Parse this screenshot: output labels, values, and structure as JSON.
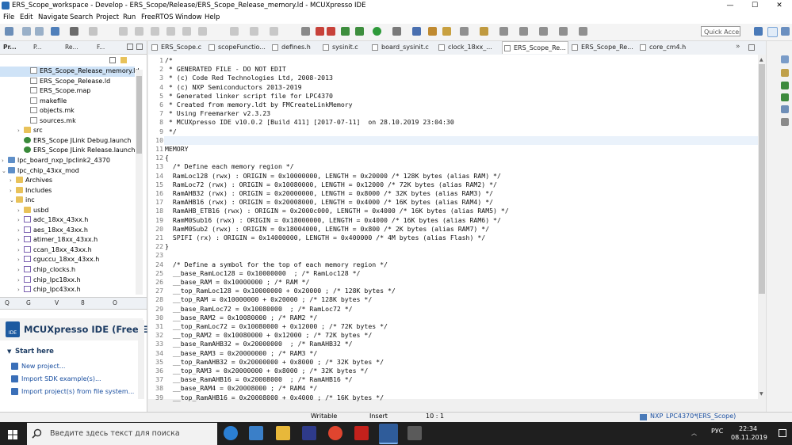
{
  "window": {
    "title": "ERS_Scope_workspace - Develop - ERS_Scope/Release/ERS_Scope_Release_memory.ld - MCUXpresso IDE"
  },
  "menu": [
    "File",
    "Edit",
    "Navigate",
    "Search",
    "Project",
    "Run",
    "FreeRTOS",
    "Window",
    "Help"
  ],
  "toolbar": {
    "quick_access": "Quick Access"
  },
  "left_tabs": [
    "Pr...",
    "P...",
    "Re...",
    "F..."
  ],
  "tree": [
    {
      "label": "ERS_Scope_Release_memory.ld",
      "icon": "file",
      "indent": 40,
      "selected": true
    },
    {
      "label": "ERS_Scope_Release.ld",
      "icon": "file",
      "indent": 40
    },
    {
      "label": "ERS_Scope.map",
      "icon": "file",
      "indent": 40
    },
    {
      "label": "makefile",
      "icon": "file",
      "indent": 40
    },
    {
      "label": "objects.mk",
      "icon": "file",
      "indent": 40
    },
    {
      "label": "sources.mk",
      "icon": "file",
      "indent": 40
    },
    {
      "label": "src",
      "icon": "folder",
      "indent": 32,
      "exp": "›"
    },
    {
      "label": "ERS_Scope JLink Debug.launch",
      "icon": "launch",
      "indent": 32
    },
    {
      "label": "ERS_Scope JLink Release.launch",
      "icon": "launch",
      "indent": 32
    },
    {
      "label": "lpc_board_nxp_lpclink2_4370",
      "icon": "proj",
      "indent": 12,
      "exp": "›"
    },
    {
      "label": "lpc_chip_43xx_mod",
      "icon": "proj",
      "indent": 12,
      "exp": "⌄"
    },
    {
      "label": "Archives",
      "icon": "folder",
      "indent": 22,
      "exp": "›"
    },
    {
      "label": "Includes",
      "icon": "folder",
      "indent": 22,
      "exp": "›"
    },
    {
      "label": "inc",
      "icon": "folder",
      "indent": 22,
      "exp": "⌄"
    },
    {
      "label": "usbd",
      "icon": "folder",
      "indent": 32,
      "exp": "›"
    },
    {
      "label": "adc_18xx_43xx.h",
      "icon": "h",
      "indent": 32,
      "exp": "›"
    },
    {
      "label": "aes_18xx_43xx.h",
      "icon": "h",
      "indent": 32,
      "exp": "›"
    },
    {
      "label": "atimer_18xx_43xx.h",
      "icon": "h",
      "indent": 32,
      "exp": "›"
    },
    {
      "label": "ccan_18xx_43xx.h",
      "icon": "h",
      "indent": 32,
      "exp": "›"
    },
    {
      "label": "cguccu_18xx_43xx.h",
      "icon": "h",
      "indent": 32,
      "exp": "›"
    },
    {
      "label": "chip_clocks.h",
      "icon": "h",
      "indent": 32,
      "exp": "›"
    },
    {
      "label": "chip_lpc18xx.h",
      "icon": "h",
      "indent": 32,
      "exp": "›"
    },
    {
      "label": "chip_lpc43xx.h",
      "icon": "h",
      "indent": 32,
      "exp": "›"
    }
  ],
  "bottom_tabs": [
    "Q",
    "G",
    "V",
    "8",
    "O"
  ],
  "mcu_panel": {
    "title": "MCUXpresso IDE (Free Edit",
    "logo": "IDE",
    "start_here": "Start here",
    "links": [
      "New project...",
      "Import SDK example(s)...",
      "Import project(s) from file system..."
    ]
  },
  "editor_tabs": [
    "ERS_Scope.c",
    "scopeFunctio...",
    "defines.h",
    "sysinit.c",
    "board_sysinit.c",
    "clock_18xx_...",
    "ERS_Scope_Re...",
    "ERS_Scope_Re...",
    "core_cm4.h"
  ],
  "editor_lines": [
    "/*",
    " * GENERATED FILE - DO NOT EDIT",
    " * (c) Code Red Technologies Ltd, 2008-2013",
    " * (c) NXP Semiconductors 2013-2019",
    " * Generated linker script file for LPC4370",
    " * Created from memory.ldt by FMCreateLinkMemory",
    " * Using Freemarker v2.3.23",
    " * MCUXpresso IDE v10.0.2 [Build 411] [2017-07-11]  on 28.10.2019 23:04:30",
    " */",
    "",
    "MEMORY",
    "{",
    "  /* Define each memory region */",
    "  RamLoc128 (rwx) : ORIGIN = 0x10000000, LENGTH = 0x20000 /* 128K bytes (alias RAM) */",
    "  RamLoc72 (rwx) : ORIGIN = 0x10080000, LENGTH = 0x12000 /* 72K bytes (alias RAM2) */",
    "  RamAHB32 (rwx) : ORIGIN = 0x20000000, LENGTH = 0x8000 /* 32K bytes (alias RAM3) */",
    "  RamAHB16 (rwx) : ORIGIN = 0x20008000, LENGTH = 0x4000 /* 16K bytes (alias RAM4) */",
    "  RamAHB_ETB16 (rwx) : ORIGIN = 0x2000c000, LENGTH = 0x4000 /* 16K bytes (alias RAM5) */",
    "  RamM0Sub16 (rwx) : ORIGIN = 0x18000000, LENGTH = 0x4000 /* 16K bytes (alias RAM6) */",
    "  RamM0Sub2 (rwx) : ORIGIN = 0x18004000, LENGTH = 0x800 /* 2K bytes (alias RAM7) */",
    "  SPIFI (rx) : ORIGIN = 0x14000000, LENGTH = 0x400000 /* 4M bytes (alias Flash) */",
    "}",
    "",
    "  /* Define a symbol for the top of each memory region */",
    "  __base_RamLoc128 = 0x10000000  ; /* RamLoc128 */",
    "  __base_RAM = 0x10000000 ; /* RAM */",
    "  __top_RamLoc128 = 0x10000000 + 0x20000 ; /* 128K bytes */",
    "  __top_RAM = 0x10000000 + 0x20000 ; /* 128K bytes */",
    "  __base_RamLoc72 = 0x10080000  ; /* RamLoc72 */",
    "  __base_RAM2 = 0x10080000 ; /* RAM2 */",
    "  __top_RamLoc72 = 0x10080000 + 0x12000 ; /* 72K bytes */",
    "  __top_RAM2 = 0x10080000 + 0x12000 ; /* 72K bytes */",
    "  __base_RamAHB32 = 0x20000000  ; /* RamAHB32 */",
    "  __base_RAM3 = 0x20000000 ; /* RAM3 */",
    "  __top_RamAHB32 = 0x20000000 + 0x8000 ; /* 32K bytes */",
    "  __top_RAM3 = 0x20000000 + 0x8000 ; /* 32K bytes */",
    "  __base_RamAHB16 = 0x20008000  ; /* RamAHB16 */",
    "  __base_RAM4 = 0x20008000 ; /* RAM4 */",
    "  __top_RamAHB16 = 0x20008000 + 0x4000 ; /* 16K bytes */"
  ],
  "status": {
    "writable": "Writable",
    "insert": "Insert",
    "position": "10 : 1",
    "nxp": "NXP",
    "chip": "LPC4370*",
    "project": "(ERS_Scope)"
  },
  "taskbar": {
    "search_placeholder": "Введите здесь текст для поиска",
    "lang": "РУС",
    "time": "22:34",
    "date": "08.11.2019"
  }
}
